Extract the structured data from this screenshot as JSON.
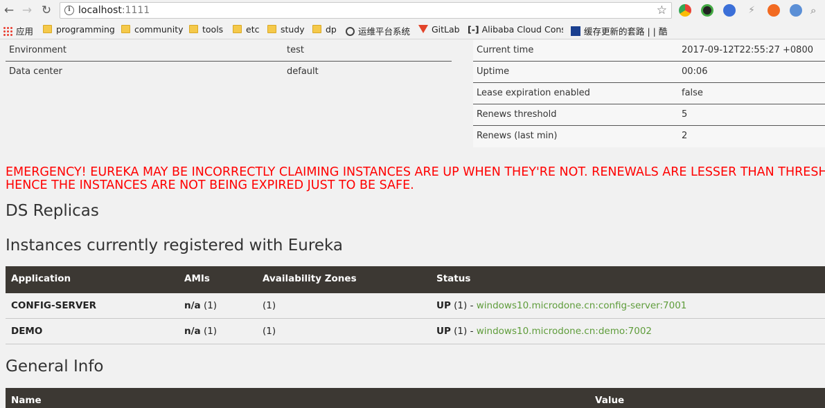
{
  "browser": {
    "url_host": "localhost",
    "url_port": ":1111",
    "bookmarks": [
      {
        "label": "应用",
        "type": "apps"
      },
      {
        "label": "programming",
        "type": "folder"
      },
      {
        "label": "community",
        "type": "folder"
      },
      {
        "label": "tools",
        "type": "folder"
      },
      {
        "label": "etc",
        "type": "folder"
      },
      {
        "label": "study",
        "type": "folder"
      },
      {
        "label": "dp",
        "type": "folder"
      },
      {
        "label": "运维平台系统",
        "type": "site"
      },
      {
        "label": "GitLab",
        "type": "site"
      },
      {
        "label": "Alibaba Cloud Cons",
        "type": "site"
      },
      {
        "label": "缓存更新的套路 | | 酷",
        "type": "site"
      }
    ]
  },
  "env_table": [
    {
      "key": "Environment",
      "value": "test"
    },
    {
      "key": "Data center",
      "value": "default"
    }
  ],
  "status_table": [
    {
      "key": "Current time",
      "value": "2017-09-12T22:55:27 +0800"
    },
    {
      "key": "Uptime",
      "value": "00:06"
    },
    {
      "key": "Lease expiration enabled",
      "value": "false"
    },
    {
      "key": "Renews threshold",
      "value": "5"
    },
    {
      "key": "Renews (last min)",
      "value": "2"
    }
  ],
  "emergency": {
    "line1": "EMERGENCY! EUREKA MAY BE INCORRECTLY CLAIMING INSTANCES ARE UP WHEN THEY'RE NOT. RENEWALS ARE LESSER THAN THRESHOLD AND",
    "line2": "HENCE THE INSTANCES ARE NOT BEING EXPIRED JUST TO BE SAFE."
  },
  "headings": {
    "ds_replicas": "DS Replicas",
    "instances": "Instances currently registered with Eureka",
    "general_info": "General Info"
  },
  "instances_table": {
    "headers": [
      "Application",
      "AMIs",
      "Availability Zones",
      "Status"
    ],
    "rows": [
      {
        "application": "CONFIG-SERVER",
        "amis_label": "n/a",
        "amis_count": "(1)",
        "zones": "(1)",
        "status": "UP",
        "status_count": "(1) -",
        "instance_link": "windows10.microdone.cn:config-server:7001"
      },
      {
        "application": "DEMO",
        "amis_label": "n/a",
        "amis_count": "(1)",
        "zones": "(1)",
        "status": "UP",
        "status_count": "(1) -",
        "instance_link": "windows10.microdone.cn:demo:7002"
      }
    ]
  },
  "general_info_table": {
    "headers": [
      "Name",
      "Value"
    ]
  },
  "colors": {
    "emergency": "#ff0000",
    "table_header_bg": "#3c3833",
    "link": "#5e9c3a"
  }
}
